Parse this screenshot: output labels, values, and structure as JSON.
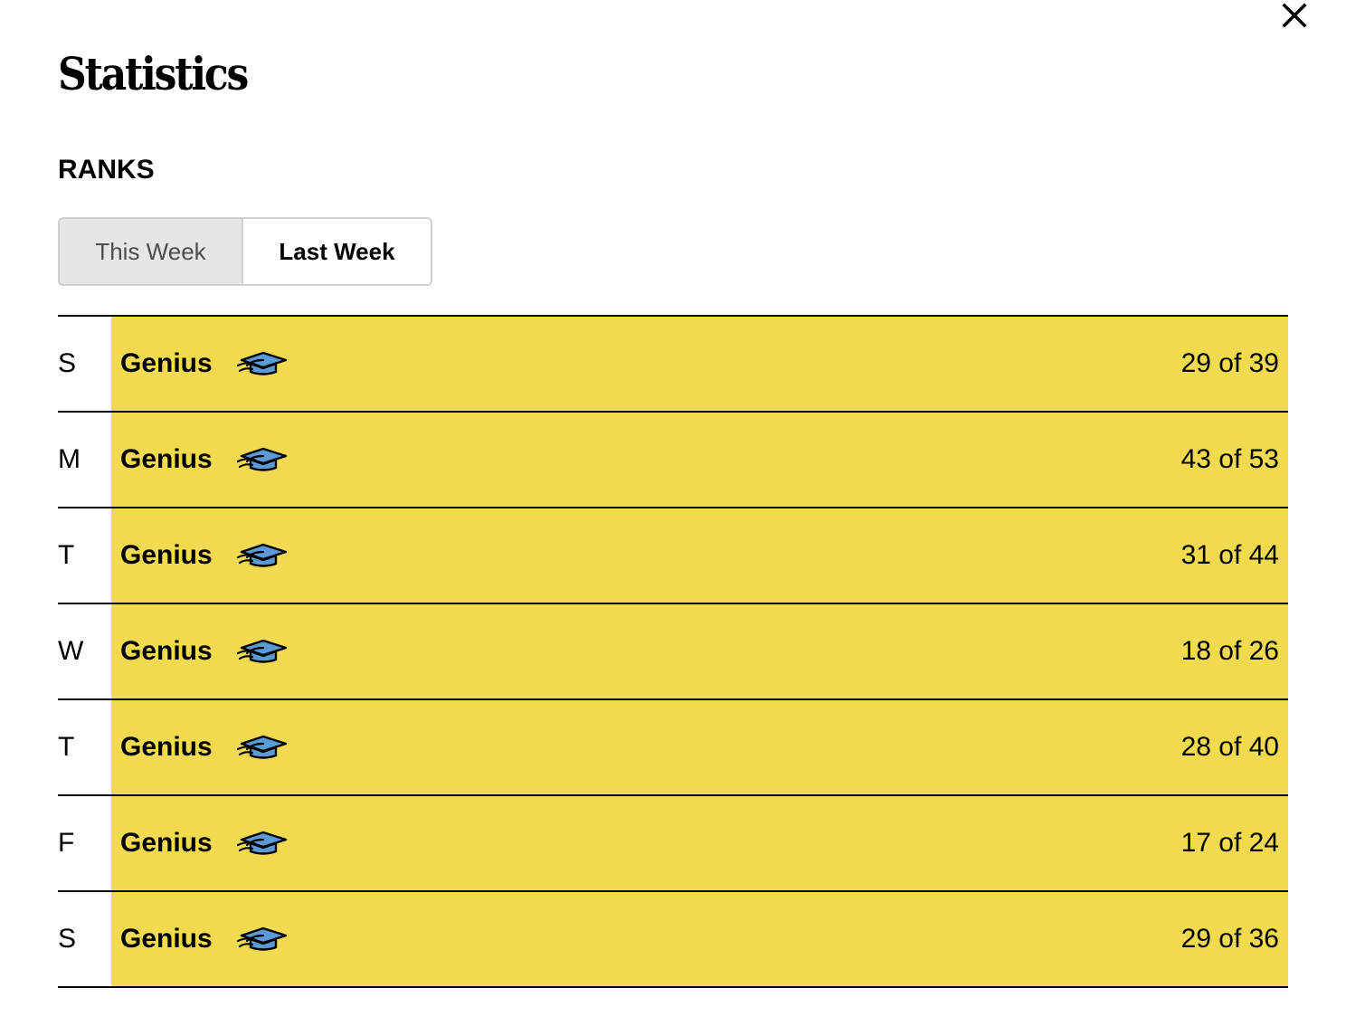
{
  "modal": {
    "title": "Statistics",
    "close_icon": "close-icon"
  },
  "ranks": {
    "heading": "RANKS",
    "tabs": [
      {
        "label": "This Week",
        "selected": false
      },
      {
        "label": "Last Week",
        "selected": true
      }
    ],
    "rank_icon": "graduation-cap-icon",
    "colors": {
      "bar": "#f1da50",
      "cap": "#5b9bd5"
    },
    "rows": [
      {
        "day": "S",
        "rank": "Genius",
        "score": "29 of 39"
      },
      {
        "day": "M",
        "rank": "Genius",
        "score": "43 of 53"
      },
      {
        "day": "T",
        "rank": "Genius",
        "score": "31 of 44"
      },
      {
        "day": "W",
        "rank": "Genius",
        "score": "18 of 26"
      },
      {
        "day": "T",
        "rank": "Genius",
        "score": "28 of 40"
      },
      {
        "day": "F",
        "rank": "Genius",
        "score": "17 of 24"
      },
      {
        "day": "S",
        "rank": "Genius",
        "score": "29 of 36"
      }
    ]
  }
}
